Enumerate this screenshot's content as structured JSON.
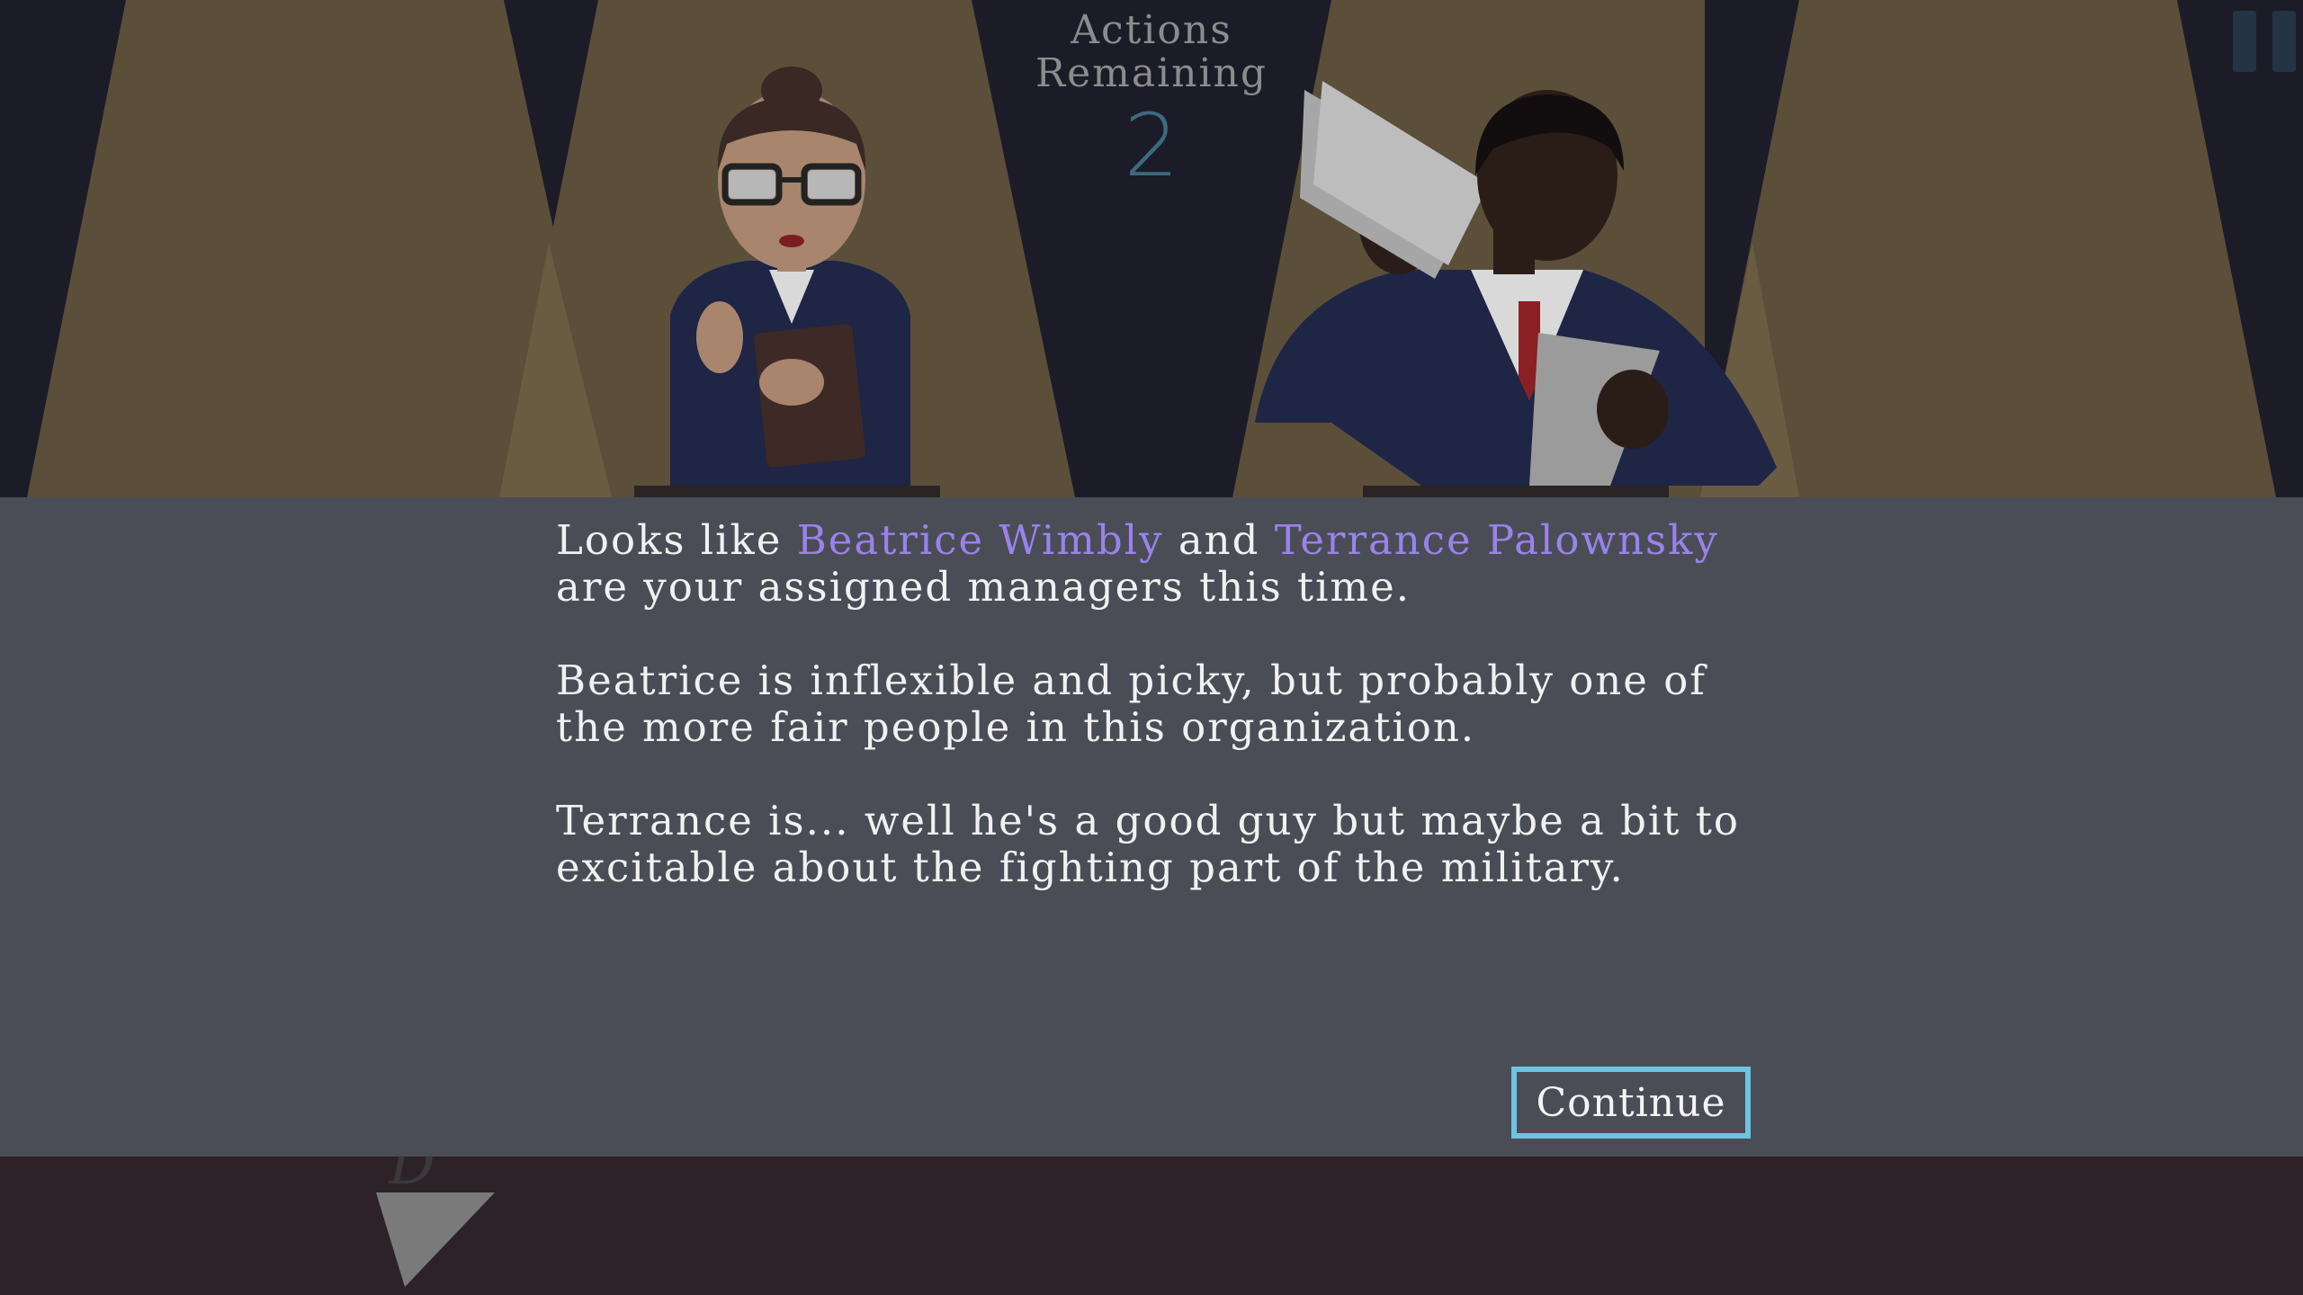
{
  "hud": {
    "actions_label_line1": "Actions",
    "actions_label_line2": "Remaining",
    "actions_remaining": "2"
  },
  "pause": {
    "icon": "pause-icon"
  },
  "dialog": {
    "p1": {
      "prefix": "Looks like ",
      "name1": "Beatrice Wimbly",
      "middle": " and ",
      "name2": "Terrance Palownsky",
      "suffix": " are your assigned managers this time."
    },
    "p2": "Beatrice is inflexible and picky, but probably one of the more fair people in this organization.",
    "p3": "Terrance is... well he's a good guy but maybe a bit to excitable about the fighting part of the military.",
    "continue_label": "Continue"
  },
  "footer": {
    "arrow_letter": "D",
    "arrow_icon": "down-arrow-icon"
  },
  "colors": {
    "highlight_name": "#9b82ea",
    "button_border": "#6ec3e3",
    "dialog_bg": "#4a4d56",
    "scene_bg": "#1c1c28",
    "spotlight": "#5b4f3a",
    "footer_bg": "#2d2227"
  }
}
